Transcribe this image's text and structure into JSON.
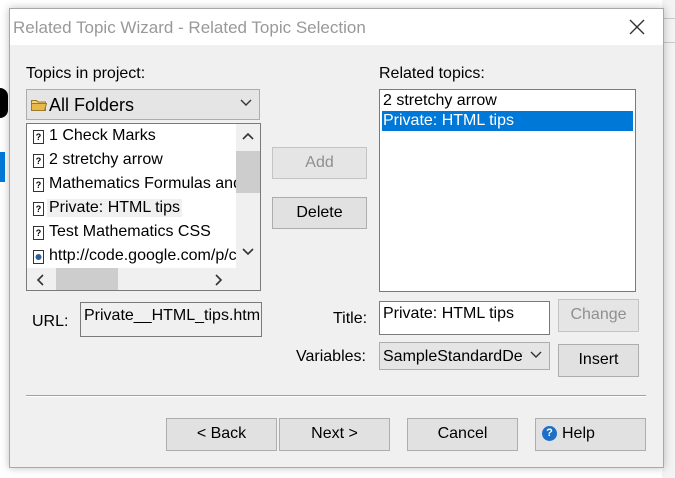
{
  "window": {
    "title": "Related Topic Wizard - Related Topic Selection"
  },
  "left": {
    "label": "Topics in project:",
    "folder_combo": {
      "value": "All Folders"
    },
    "topics": [
      {
        "label": "1 Check Marks",
        "icon": "help-page-icon"
      },
      {
        "label": "2 stretchy arrow",
        "icon": "help-page-icon"
      },
      {
        "label": "Mathematics Formulas and",
        "icon": "help-page-icon"
      },
      {
        "label": "Private: HTML tips",
        "icon": "help-page-icon",
        "selected": true
      },
      {
        "label": "Test Mathematics CSS",
        "icon": "help-page-icon"
      },
      {
        "label": "http://code.google.com/p/c",
        "icon": "link-icon"
      }
    ],
    "url_label": "URL:",
    "url_value": "Private__HTML_tips.htm"
  },
  "middle": {
    "add_label": "Add",
    "delete_label": "Delete"
  },
  "right": {
    "label": "Related topics:",
    "topics": [
      {
        "label": "2 stretchy arrow",
        "selected": false
      },
      {
        "label": "Private: HTML tips",
        "selected": true
      }
    ],
    "title_label": "Title:",
    "title_value": "Private: HTML tips",
    "change_label": "Change",
    "variables_label": "Variables:",
    "variables_value": "SampleStandardDeviation",
    "insert_label": "Insert"
  },
  "footer": {
    "back_label": "< Back",
    "next_label": "Next >",
    "cancel_label": "Cancel",
    "help_label": "Help"
  },
  "colors": {
    "selection": "#0078d7",
    "dialog_bg": "#f0f0f0",
    "button_bg": "#e1e1e1"
  }
}
